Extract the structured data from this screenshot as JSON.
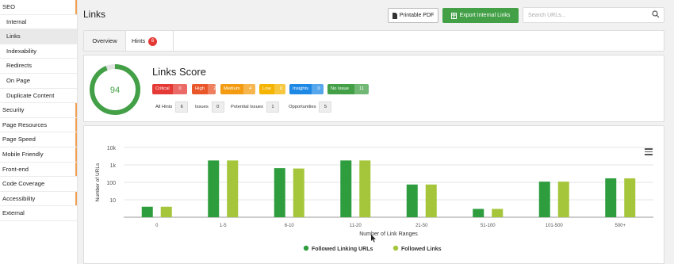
{
  "sidebar": {
    "items": [
      {
        "label": "SEO",
        "sub": false,
        "active": false,
        "accent": true
      },
      {
        "label": "Internal",
        "sub": true,
        "active": false,
        "accent": false
      },
      {
        "label": "Links",
        "sub": true,
        "active": true,
        "accent": false
      },
      {
        "label": "Indexability",
        "sub": true,
        "active": false,
        "accent": false
      },
      {
        "label": "Redirects",
        "sub": true,
        "active": false,
        "accent": false
      },
      {
        "label": "On Page",
        "sub": true,
        "active": false,
        "accent": false
      },
      {
        "label": "Duplicate Content",
        "sub": true,
        "active": false,
        "accent": false
      },
      {
        "label": "Security",
        "sub": false,
        "active": false,
        "accent": true
      },
      {
        "label": "Page Resources",
        "sub": false,
        "active": false,
        "accent": true
      },
      {
        "label": "Page Speed",
        "sub": false,
        "active": false,
        "accent": true
      },
      {
        "label": "Mobile Friendly",
        "sub": false,
        "active": false,
        "accent": true
      },
      {
        "label": "Front-end",
        "sub": false,
        "active": false,
        "accent": true
      },
      {
        "label": "Code Coverage",
        "sub": false,
        "active": false,
        "accent": false
      },
      {
        "label": "Accessibility",
        "sub": false,
        "active": false,
        "accent": true
      },
      {
        "label": "External",
        "sub": false,
        "active": false,
        "accent": false
      }
    ]
  },
  "header": {
    "title": "Links",
    "pdf_label": "Printable PDF",
    "export_label": "Export Internal Links",
    "search_placeholder": "Search URLs..."
  },
  "tabs": {
    "overview": "Overview",
    "hints": "Hints",
    "hints_count": "6"
  },
  "score": {
    "value": 94,
    "title": "Links Score",
    "badges": [
      {
        "label": "Critical",
        "count": "0",
        "color": "#e53935"
      },
      {
        "label": "High",
        "count": "2",
        "color": "#e8562a"
      },
      {
        "label": "Medium",
        "count": "4",
        "color": "#f39c12"
      },
      {
        "label": "Low",
        "count": "0",
        "color": "#f4b400"
      },
      {
        "label": "Insights",
        "count": "0",
        "color": "#1e88e5"
      },
      {
        "label": "No Issue",
        "count": "11",
        "color": "#43a047"
      }
    ],
    "stats": [
      {
        "label": "All Hints",
        "count": "6"
      },
      {
        "label": "Issues",
        "count": "0"
      },
      {
        "label": "Potential Issues",
        "count": "1"
      },
      {
        "label": "Opportunities",
        "count": "5"
      }
    ]
  },
  "chart_data": {
    "type": "bar",
    "title": "",
    "xlabel": "Number of Link Ranges",
    "ylabel": "Number of URLs",
    "yscale": "log",
    "ylim": [
      1,
      10000
    ],
    "yticks": [
      "10k",
      "1k",
      "100",
      "10"
    ],
    "categories": [
      "0",
      "1-5",
      "6-10",
      "11-20",
      "21-50",
      "51-100",
      "101-500",
      "500+"
    ],
    "series": [
      {
        "name": "Followed Linking URLs",
        "color": "#2e9d3e",
        "values": [
          4,
          1800,
          650,
          1800,
          75,
          3,
          110,
          170
        ]
      },
      {
        "name": "Followed Links",
        "color": "#a5c63b",
        "values": [
          4,
          1800,
          620,
          1800,
          75,
          3,
          110,
          170
        ]
      }
    ],
    "legend": "bottom"
  }
}
